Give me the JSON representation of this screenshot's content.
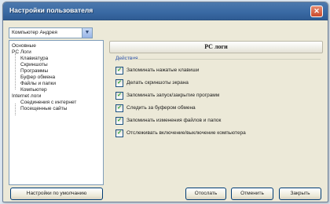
{
  "window": {
    "title": "Настройки пользователя"
  },
  "user_select": {
    "value": "Компьютер Андрея"
  },
  "tree": {
    "items": [
      "Основные",
      "PC Логи",
      "Клавиатура",
      "Скриншоты",
      "Программы",
      "Буфер обмена",
      "Файлы и папки",
      "Компьютер",
      "Internet логи",
      "Соединения с интернет",
      "Посещенные сайты"
    ]
  },
  "panel": {
    "header": "PC логи",
    "section": "Действия",
    "options": [
      {
        "label": "Запоминать нажатые клавиши",
        "checked": true
      },
      {
        "label": "Делать скриншоты экрана",
        "checked": true
      },
      {
        "label": "Запоминать запуск/закрытие программ",
        "checked": true
      },
      {
        "label": "Следить за буфером обмена",
        "checked": true
      },
      {
        "label": "Запоминать изменения файлов и папок",
        "checked": true
      },
      {
        "label": "Отслеживать включение/выключение компьютера",
        "checked": true
      }
    ]
  },
  "buttons": {
    "defaults": "Настройки по умолчанию",
    "cancel": "Отослать",
    "apply": "Отменить",
    "close": "Закрыть"
  },
  "colors": {
    "titlebar": "#3a6aa4",
    "section_label": "#2a50a8",
    "checkmark": "#21a121"
  }
}
